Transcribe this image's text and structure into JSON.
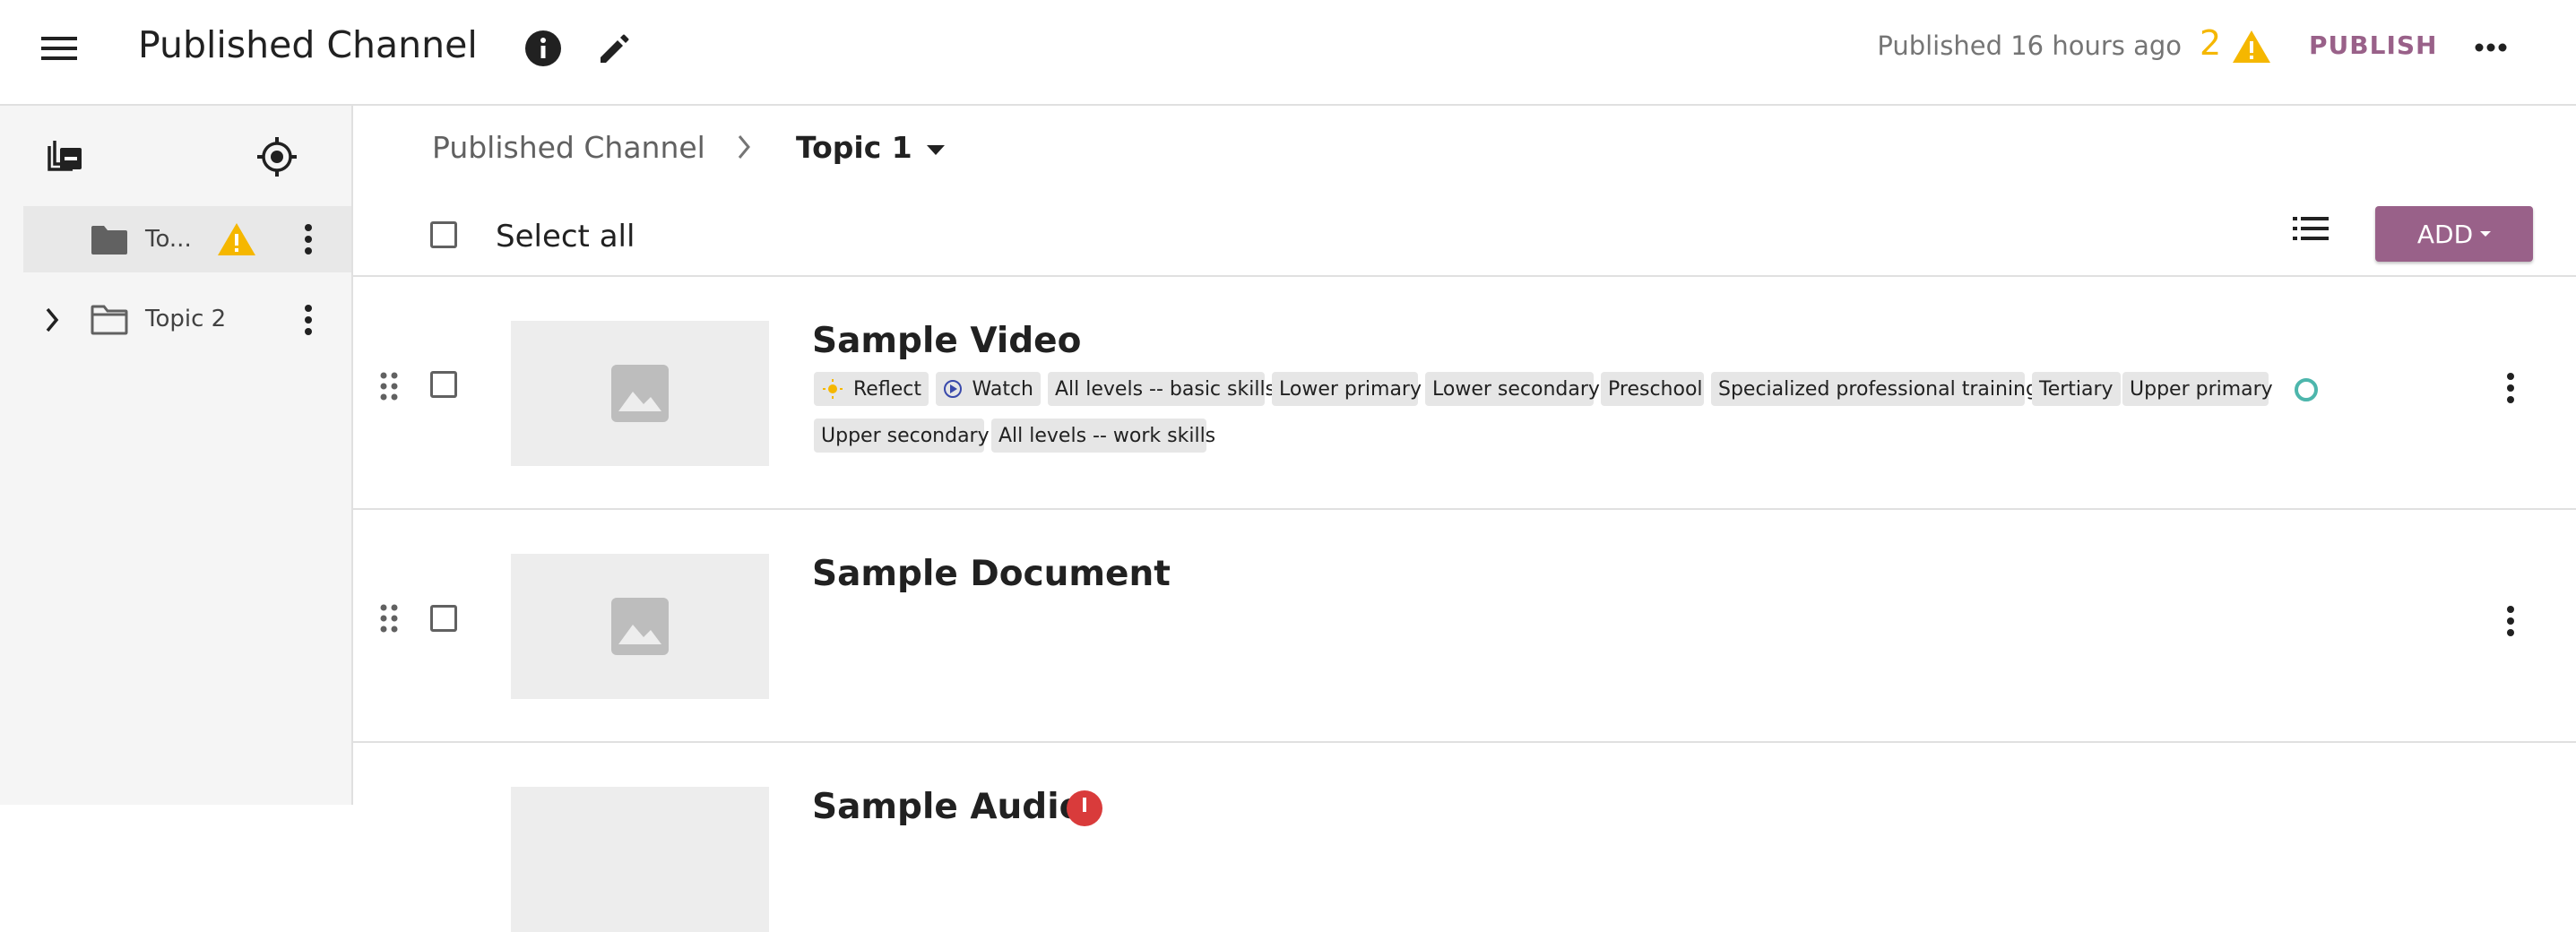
{
  "header": {
    "title": "Published Channel",
    "published_text": "Published 16 hours ago",
    "error_count": "2",
    "publish_label": "PUBLISH"
  },
  "sidebar": {
    "items": [
      {
        "label": "To...",
        "active": true,
        "has_warning": true
      },
      {
        "label": "Topic 2",
        "active": false,
        "has_warning": false
      }
    ]
  },
  "breadcrumb": {
    "root": "Published Channel",
    "current": "Topic 1"
  },
  "toolbar": {
    "select_all": "Select all",
    "add_label": "ADD"
  },
  "content": {
    "items": [
      {
        "title": "Sample Video",
        "tags": [
          "Reflect",
          "Watch",
          "All levels -- basic skills",
          "Lower primary",
          "Lower secondary",
          "Preschool",
          "Specialized professional training",
          "Tertiary",
          "Upper primary",
          "Upper secondary",
          "All levels -- work skills"
        ]
      },
      {
        "title": "Sample Document",
        "tags": []
      },
      {
        "title": "Sample Audio",
        "tags": [],
        "has_error": true
      }
    ]
  },
  "colors": {
    "accent": "#996189",
    "warning": "#f5b700",
    "error": "#d93b3b",
    "status_ring": "#4db6ac"
  }
}
